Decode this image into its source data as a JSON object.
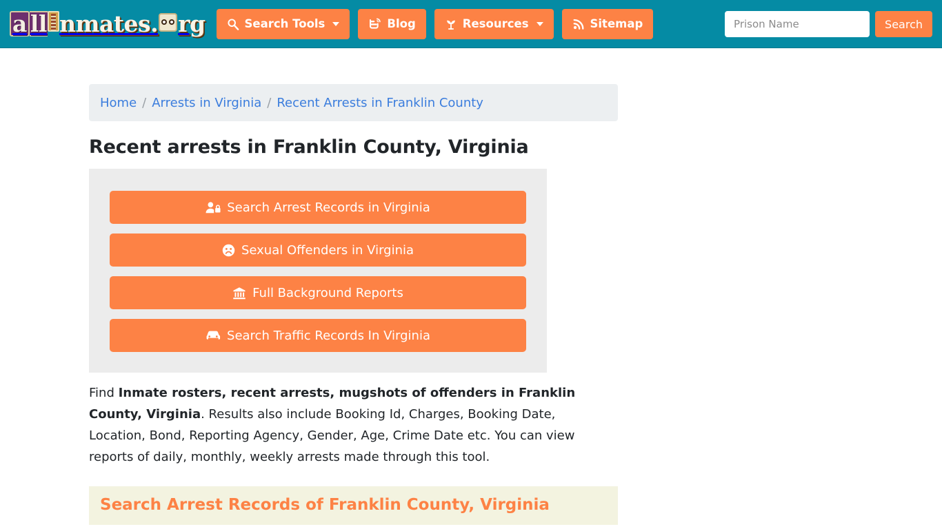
{
  "header": {
    "logo": {
      "text": "allInmates.org",
      "part_a": "a",
      "part_ll": "ll",
      "part_rest": "nmates.",
      "part_tld": "rg"
    },
    "nav": [
      {
        "label": "Search Tools",
        "icon": "magnifier-icon",
        "has_caret": true
      },
      {
        "label": "Blog",
        "icon": "blogger-icon",
        "has_caret": false
      },
      {
        "label": "Resources",
        "icon": "seedling-icon",
        "has_caret": true
      },
      {
        "label": "Sitemap",
        "icon": "rss-icon",
        "has_caret": false
      }
    ],
    "search": {
      "placeholder": "Prison Name",
      "value": "",
      "button_label": "Search"
    }
  },
  "breadcrumb": {
    "home": "Home",
    "sep": "/",
    "parent": "Arrests in Virginia",
    "current": "Recent Arrests in Franklin County"
  },
  "main": {
    "title": "Recent arrests in Franklin County, Virginia",
    "buttons": [
      {
        "label": "Search Arrest Records in Virginia",
        "icon": "user-lock-icon"
      },
      {
        "label": "Sexual Offenders in Virginia",
        "icon": "frown-face-icon"
      },
      {
        "label": "Full Background Reports",
        "icon": "landmark-icon"
      },
      {
        "label": "Search Traffic Records In Virginia",
        "icon": "car-icon"
      }
    ],
    "lead": {
      "pre": "Find ",
      "bold1": "Inmate rosters, recent arrests, mugshots of offenders in Franklin County, Virginia",
      "post": ". Results also include Booking Id, Charges, Booking Date, Location, Bond, Reporting Agency, Gender, Age, Crime Date etc. You can view reports of daily, monthly, weekly arrests made through this tool."
    },
    "section_heading": "Search Arrest Records of Franklin County, Virginia"
  },
  "colors": {
    "header_teal": "#058ba4",
    "accent_orange": "#fd8245",
    "link_blue": "#3b7ddd",
    "panel_gray": "#ececec",
    "breadcrumb_gray": "#eceff1",
    "section_cream": "#f3f3e0"
  }
}
